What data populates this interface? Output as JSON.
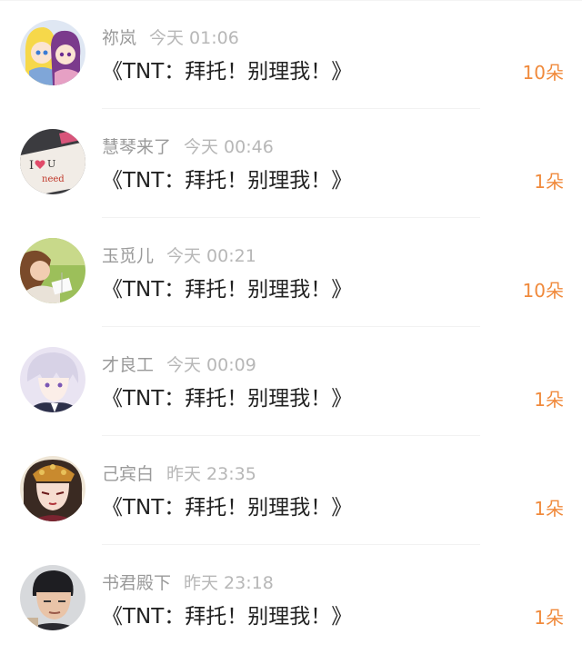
{
  "accent_color": "#f08a3c",
  "items": [
    {
      "name": "祢岚",
      "time": "今天 01:06",
      "title": "《TNT：拜托！别理我！》",
      "count": "10朵",
      "avatar": "avatar-anime-pair"
    },
    {
      "name": "慧琴来了",
      "time": "今天 00:46",
      "title": "《TNT：拜托！别理我！》",
      "count": "1朵",
      "avatar": "avatar-i-love-you-note"
    },
    {
      "name": "玉觅儿",
      "time": "今天 00:21",
      "title": "《TNT：拜托！别理我！》",
      "count": "10朵",
      "avatar": "avatar-girl-reading"
    },
    {
      "name": "才良工",
      "time": "今天 00:09",
      "title": "《TNT：拜托！别理我！》",
      "count": "1朵",
      "avatar": "avatar-anime-boy"
    },
    {
      "name": "己宾白",
      "time": "昨天 23:35",
      "title": "《TNT：拜托！别理我！》",
      "count": "1朵",
      "avatar": "avatar-anime-girl-crown"
    },
    {
      "name": "书君殿下",
      "time": "昨天 23:18",
      "title": "《TNT：拜托！别理我！》",
      "count": "1朵",
      "avatar": "avatar-young-man"
    }
  ]
}
